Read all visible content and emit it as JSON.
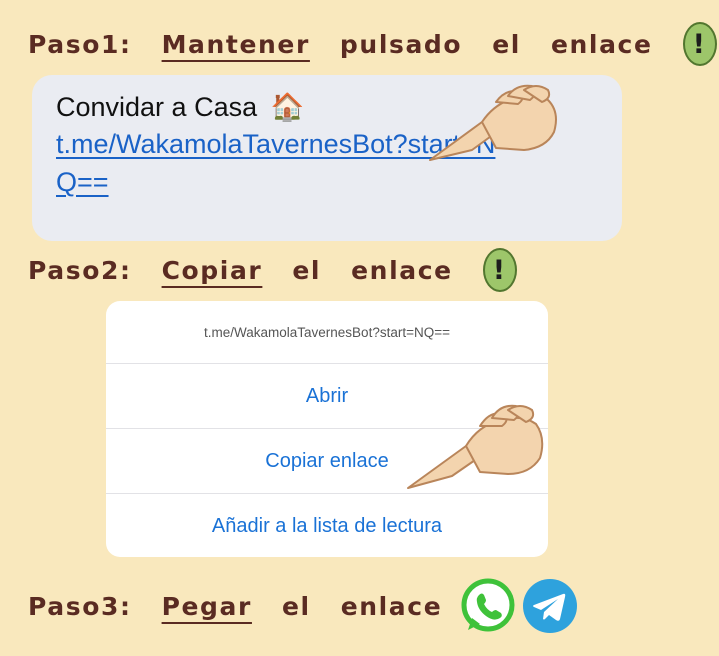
{
  "step1": {
    "label": "Paso1:",
    "action": "Mantener",
    "rest1": "pulsado",
    "rest2": "el",
    "rest3": "enlace",
    "badge": "!"
  },
  "chat_bubble": {
    "title": "Convidar a Casa",
    "title_emoji": "🏠",
    "link_text": "t.me/WakamolaTavernesBot?start=NQ=="
  },
  "step2": {
    "label": "Paso2:",
    "action": "Copiar",
    "rest1": "el",
    "rest2": "enlace",
    "badge": "!"
  },
  "action_sheet": {
    "header": "t.me/WakamolaTavernesBot?start=NQ==",
    "items": [
      "Abrir",
      "Copiar enlace",
      "Añadir a la lista de lectura"
    ]
  },
  "step3": {
    "label": "Paso3:",
    "action": "Pegar",
    "rest1": "el",
    "rest2": "enlace",
    "apps": [
      "whatsapp-icon",
      "telegram-icon"
    ]
  },
  "colors": {
    "background": "#f9e8bd",
    "heading_text": "#5a2b22",
    "link_blue": "#1a62c7",
    "ios_blue": "#1a72d6",
    "avocado_green": "#9dc66a",
    "whatsapp_green": "#3fc23a",
    "telegram_blue": "#2ea2dd"
  },
  "icons": [
    "pointing-hand-icon",
    "exclamation-avocado-icon",
    "house-icon"
  ]
}
